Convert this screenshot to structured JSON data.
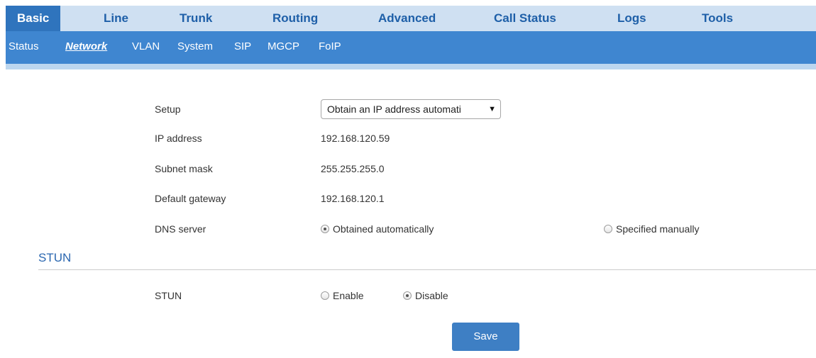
{
  "top_tabs": [
    "Basic",
    "Line",
    "Trunk",
    "Routing",
    "Advanced",
    "Call Status",
    "Logs",
    "Tools"
  ],
  "sub_tabs": [
    "Status",
    "Network",
    "VLAN",
    "System",
    "SIP",
    "MGCP",
    "FoIP"
  ],
  "active_top_tab": "Basic",
  "active_sub_tab": "Network",
  "network": {
    "setup_label": "Setup",
    "setup_value": "Obtain an IP address automati",
    "ip_label": "IP address",
    "ip_value": "192.168.120.59",
    "subnet_label": "Subnet mask",
    "subnet_value": "255.255.255.0",
    "gateway_label": "Default gateway",
    "gateway_value": "192.168.120.1",
    "dns_label": "DNS server",
    "dns_auto": "Obtained automatically",
    "dns_manual": "Specified manually",
    "dns_selected": "auto"
  },
  "stun": {
    "section_title": "STUN",
    "label": "STUN",
    "enable": "Enable",
    "disable": "Disable",
    "selected": "disable"
  },
  "save_label": "Save",
  "colors": {
    "accent": "#2f74bd",
    "subnav": "#3f86d0",
    "topnav_bg": "#cfe0f2",
    "button": "#3e7fc4"
  },
  "icons": {
    "dropdown": "chevron-down-icon",
    "radio_on": "radio-checked-icon",
    "radio_off": "radio-unchecked-icon"
  }
}
